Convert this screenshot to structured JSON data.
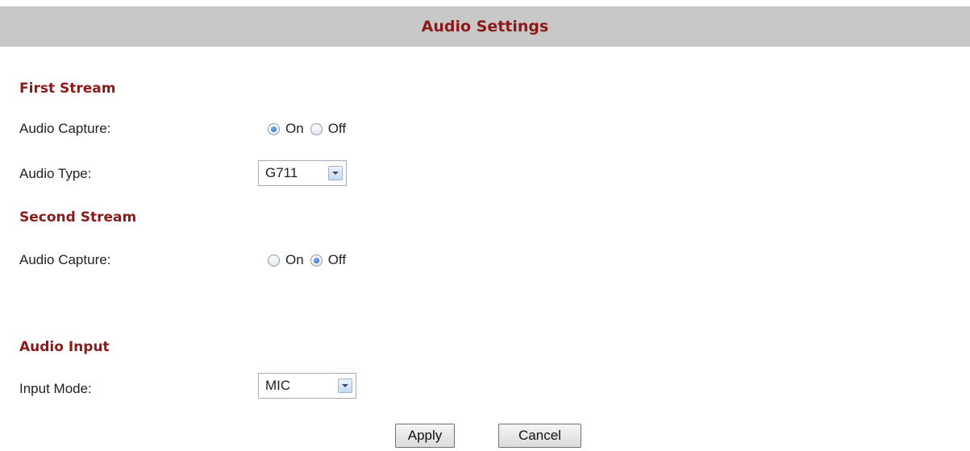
{
  "header": {
    "title": "Audio Settings"
  },
  "first_stream": {
    "heading": "First Stream",
    "audio_capture": {
      "label": "Audio Capture:",
      "on_label": "On",
      "off_label": "Off",
      "selected": "On"
    },
    "audio_type": {
      "label": "Audio Type:",
      "value": "G711"
    }
  },
  "second_stream": {
    "heading": "Second Stream",
    "audio_capture": {
      "label": "Audio Capture:",
      "on_label": "On",
      "off_label": "Off",
      "selected": "Off"
    }
  },
  "audio_input": {
    "heading": "Audio Input",
    "input_mode": {
      "label": "Input Mode:",
      "value": "MIC"
    }
  },
  "actions": {
    "apply_label": "Apply",
    "cancel_label": "Cancel"
  },
  "colors": {
    "heading": "#8b1a1a",
    "title_bar": "#c8c8c8"
  },
  "icons": [
    "radio-on",
    "radio-off",
    "dropdown-arrow-icon"
  ]
}
